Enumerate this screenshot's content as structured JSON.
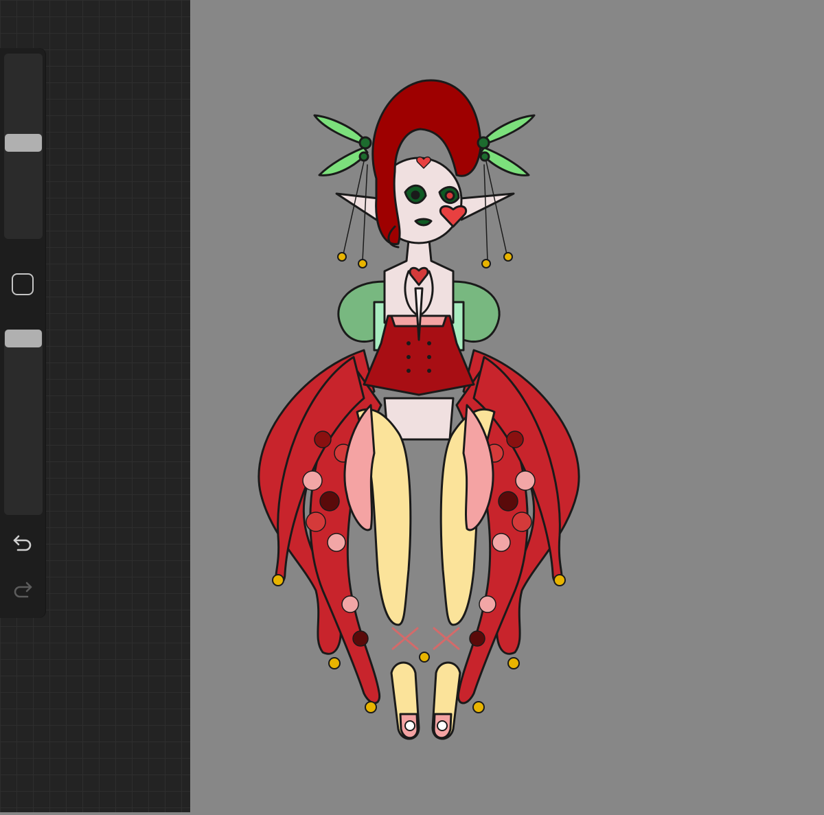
{
  "app": {
    "accent": "#b0b0b0",
    "panel_bg": "#232323",
    "canvas_bg": "#878787"
  },
  "sidebar": {
    "brush_size": {
      "value": 0.52
    },
    "opacity": {
      "value": 1.0
    },
    "modify_icon": "square-icon",
    "undo_icon": "undo-arrow-icon",
    "redo_icon": "redo-arrow-icon"
  },
  "artwork": {
    "palette": {
      "hair": "#9e0000",
      "skin": "#f0e0e0",
      "leaf": "#7ce07c",
      "mint": "#a8ecc0",
      "dress": "#a80e14",
      "scale_light": "#f2a6a6",
      "scale_mid": "#d43a3a",
      "scale_dark": "#5a0a0a",
      "yellow": "#fbe39a",
      "bell": "#e8b400",
      "pink": "#f4a3a3"
    }
  }
}
